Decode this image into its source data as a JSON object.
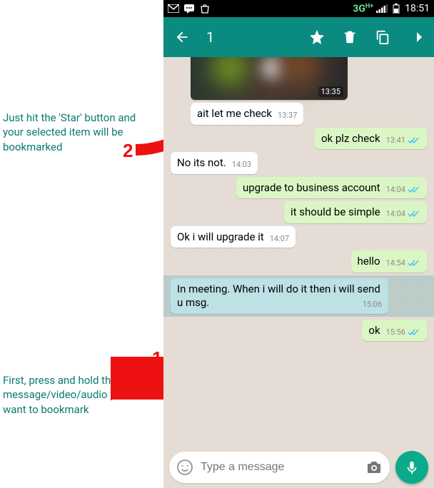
{
  "statusbar": {
    "network": "3G",
    "network_sup": "H+",
    "time": "18:51"
  },
  "toolbar": {
    "selected_count": "1"
  },
  "photo_time": "13:35",
  "messages": [
    {
      "dir": "in",
      "text": "ait let me check",
      "time": "13:37",
      "ticks": false,
      "sel": false,
      "partial": true
    },
    {
      "dir": "out",
      "text": "ok plz check",
      "time": "13:41",
      "ticks": true,
      "sel": false
    },
    {
      "dir": "in",
      "text": "No its not.",
      "time": "14:03",
      "ticks": false,
      "sel": false
    },
    {
      "dir": "out",
      "text": "upgrade to business account",
      "time": "14:04",
      "ticks": true,
      "sel": false
    },
    {
      "dir": "out",
      "text": "it should be simple",
      "time": "14:04",
      "ticks": true,
      "sel": false
    },
    {
      "dir": "in",
      "text": "Ok i will upgrade it",
      "time": "14:07",
      "ticks": false,
      "sel": false
    },
    {
      "dir": "out",
      "text": "hello",
      "time": "14:54",
      "ticks": true,
      "sel": false
    },
    {
      "dir": "in",
      "text": "In meeting. When i will do it then i will send u msg.",
      "time": "15:06",
      "ticks": false,
      "sel": true
    },
    {
      "dir": "out",
      "text": "ok",
      "time": "15:56",
      "ticks": true,
      "sel": false
    }
  ],
  "input": {
    "placeholder": "Type a message"
  },
  "annotations": {
    "top": "Just hit the 'Star' button and your selected item will be bookmarked",
    "bottom": "First, press and hold the message/video/audio you want to bookmark",
    "label1": "1",
    "label2": "2"
  }
}
